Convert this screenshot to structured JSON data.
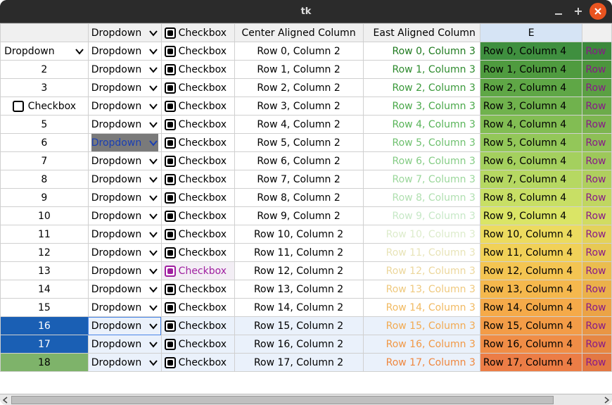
{
  "window": {
    "title": "tk"
  },
  "headers": {
    "dropdown": "Dropdown",
    "checkbox": "Checkbox",
    "center": "Center Aligned Column",
    "east": "East Aligned Column",
    "e": "E"
  },
  "dropdown_label": "Dropdown",
  "checkbox_label": "Checkbox",
  "partial_col5": "Row",
  "rows": [
    {
      "idx_type": "dropdown",
      "c2": "Row 0, Column 2",
      "c3": "Row 0, Column 3",
      "c4": "Row 0, Column 4",
      "c3_color": "#1f7a1f",
      "c4_bg": "#3f8f3f"
    },
    {
      "idx": "2",
      "c2": "Row 1, Column 2",
      "c3": "Row 1, Column 3",
      "c4": "Row 1, Column 4",
      "c3_color": "#2e8b2e",
      "c4_bg": "#4f9b3f"
    },
    {
      "idx": "3",
      "c2": "Row 2, Column 2",
      "c3": "Row 2, Column 3",
      "c4": "Row 2, Column 4",
      "c3_color": "#3c9a3c",
      "c4_bg": "#5fa746"
    },
    {
      "idx_type": "checkbox",
      "c2": "Row 3, Column 2",
      "c3": "Row 3, Column 3",
      "c4": "Row 3, Column 4",
      "c3_color": "#4aa84a",
      "c4_bg": "#70b24d"
    },
    {
      "idx": "5",
      "c2": "Row 4, Column 2",
      "c3": "Row 4, Column 3",
      "c4": "Row 4, Column 4",
      "c3_color": "#59b459",
      "c4_bg": "#82bd53"
    },
    {
      "idx": "6",
      "dd_sel": true,
      "c2": "Row 5, Column 2",
      "c3": "Row 5, Column 3",
      "c4": "Row 5, Column 4",
      "c3_color": "#6fc06f",
      "c4_bg": "#93c759"
    },
    {
      "idx": "7",
      "c2": "Row 6, Column 2",
      "c3": "Row 6, Column 3",
      "c4": "Row 6, Column 4",
      "c3_color": "#85cc85",
      "c4_bg": "#a4d05e"
    },
    {
      "idx": "8",
      "c2": "Row 7, Column 2",
      "c3": "Row 7, Column 3",
      "c4": "Row 7, Column 4",
      "c3_color": "#9bd79b",
      "c4_bg": "#b6d862"
    },
    {
      "idx": "9",
      "c2": "Row 8, Column 2",
      "c3": "Row 8, Column 3",
      "c4": "Row 8, Column 4",
      "c3_color": "#b1e0b1",
      "c4_bg": "#c8df65"
    },
    {
      "idx": "10",
      "c2": "Row 9, Column 2",
      "c3": "Row 9, Column 3",
      "c4": "Row 9, Column 4",
      "c3_color": "#c7e8c7",
      "c4_bg": "#dae566"
    },
    {
      "idx": "11",
      "c2": "Row 10, Column 2",
      "c3": "Row 10, Column 3",
      "c4": "Row 10, Column 4",
      "c3_color": "#ddeccc",
      "c4_bg": "#ecdb5f"
    },
    {
      "idx": "12",
      "c2": "Row 11, Column 2",
      "c3": "Row 11, Column 3",
      "c4": "Row 11, Column 4",
      "c3_color": "#e8e4b8",
      "c4_bg": "#f1d158"
    },
    {
      "idx": "13",
      "cb_purple": true,
      "c2": "Row 12, Column 2",
      "c3": "Row 12, Column 3",
      "c4": "Row 12, Column 4",
      "c3_color": "#ecd79c",
      "c4_bg": "#f4c552"
    },
    {
      "idx": "14",
      "c2": "Row 13, Column 2",
      "c3": "Row 13, Column 3",
      "c4": "Row 13, Column 4",
      "c3_color": "#efc97e",
      "c4_bg": "#f5b84d"
    },
    {
      "idx": "15",
      "c2": "Row 14, Column 2",
      "c3": "Row 14, Column 3",
      "c4": "Row 14, Column 4",
      "c3_color": "#f1ba62",
      "c4_bg": "#f5aa49"
    },
    {
      "idx": "16",
      "idx_sel": true,
      "sel": true,
      "dd_frame": true,
      "c2": "Row 15, Column 2",
      "c3": "Row 15, Column 3",
      "c4": "Row 15, Column 4",
      "c3_color": "#f2aa52",
      "c4_bg": "#f39c47"
    },
    {
      "idx": "17",
      "idx_sel": true,
      "sel": true,
      "c2": "Row 16, Column 2",
      "c3": "Row 16, Column 3",
      "c4": "Row 16, Column 4",
      "c3_color": "#f19947",
      "c4_bg": "#f08d46"
    },
    {
      "idx": "18",
      "idx_green": true,
      "sel": true,
      "c2": "Row 17, Column 2",
      "c3": "Row 17, Column 3",
      "c4": "Row 17, Column 4",
      "c3_color": "#ef873f",
      "c4_bg": "#ec7d46"
    }
  ]
}
